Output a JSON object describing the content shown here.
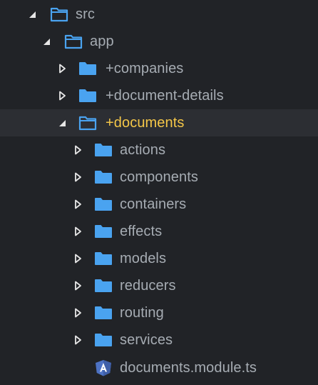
{
  "colors": {
    "background": "#212327",
    "selected_row": "#2c2e33",
    "label": "#a6acb3",
    "selected_label": "#f5c748",
    "folder": "#4aa3f0",
    "chevron": "#e6e6e6",
    "angular": "#4d72c4"
  },
  "tree": {
    "src": {
      "label": "src",
      "icon": "folder-open-icon",
      "expanded": true
    },
    "app": {
      "label": "app",
      "icon": "folder-open-icon",
      "expanded": true
    },
    "companies": {
      "label": "+companies",
      "icon": "folder-icon",
      "expanded": false
    },
    "document_details": {
      "label": "+document-details",
      "icon": "folder-icon",
      "expanded": false
    },
    "documents": {
      "label": "+documents",
      "icon": "folder-open-icon",
      "expanded": true,
      "selected": true
    },
    "children": [
      {
        "label": "actions",
        "icon": "folder-icon"
      },
      {
        "label": "components",
        "icon": "folder-icon"
      },
      {
        "label": "containers",
        "icon": "folder-icon"
      },
      {
        "label": "effects",
        "icon": "folder-icon"
      },
      {
        "label": "models",
        "icon": "folder-icon"
      },
      {
        "label": "reducers",
        "icon": "folder-icon"
      },
      {
        "label": "routing",
        "icon": "folder-icon"
      },
      {
        "label": "services",
        "icon": "folder-icon"
      }
    ],
    "module_file": {
      "label": "documents.module.ts",
      "icon": "angular-file-icon"
    }
  }
}
